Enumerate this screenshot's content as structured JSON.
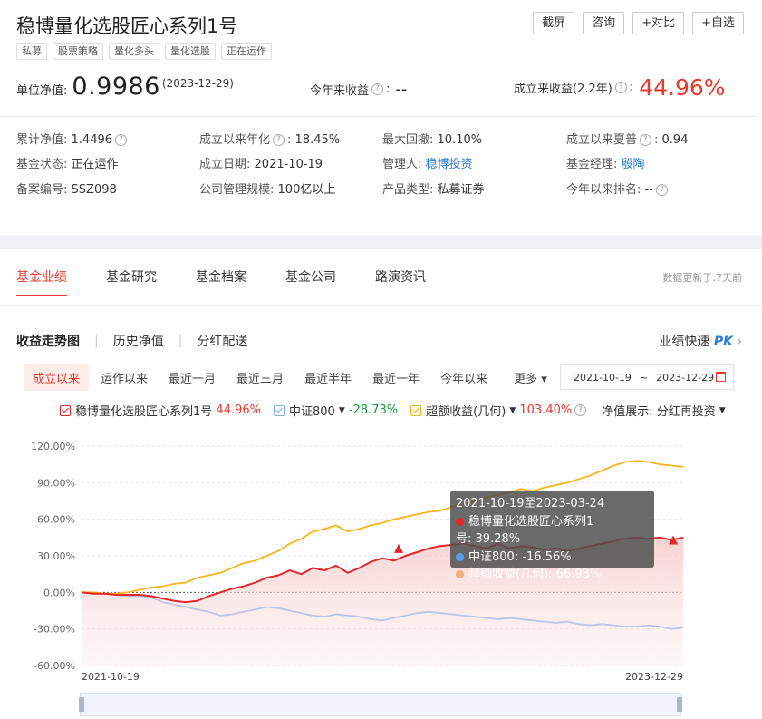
{
  "fund": {
    "title": "稳博量化选股匠心系列1号",
    "tags": [
      "私募",
      "股票策略",
      "量化多头",
      "量化选股",
      "正在运作"
    ]
  },
  "top_buttons": [
    "截屏",
    "咨询",
    "+对比",
    "+自选"
  ],
  "headline": {
    "nav_label": "单位净值:",
    "nav_value": "0.9986",
    "nav_date": "(2023-12-29)",
    "ytd_label": "今年来收益",
    "ytd_value": "--",
    "since_label": "成立来收益(2.2年)",
    "since_value": "44.96%"
  },
  "stats": [
    {
      "label": "累计净值:",
      "value": "1.4496",
      "q": true
    },
    {
      "label": "成立以来年化",
      "value": "18.45%",
      "q": true
    },
    {
      "label": "最大回撤:",
      "value": "10.10%"
    },
    {
      "label": "成立以来夏普",
      "value": "0.94",
      "q": true
    },
    {
      "label": "基金状态:",
      "value": "正在运作"
    },
    {
      "label": "成立日期:",
      "value": "2021-10-19"
    },
    {
      "label": "管理人:",
      "value": "稳博投资",
      "link": true
    },
    {
      "label": "基金经理:",
      "value": "殷陶",
      "link": true
    },
    {
      "label": "备案编号:",
      "value": "SSZ098"
    },
    {
      "label": "公司管理规模:",
      "value": "100亿以上"
    },
    {
      "label": "产品类型:",
      "value": "私募证券"
    },
    {
      "label": "今年以来排名:",
      "value": "--",
      "q": true
    }
  ],
  "tabs": [
    "基金业绩",
    "基金研究",
    "基金档案",
    "基金公司",
    "路演资讯"
  ],
  "update_text": "数据更新于:7天前",
  "subtabs": [
    "收益走势图",
    "历史净值",
    "分红配送"
  ],
  "pk_text": "业绩快速",
  "pk_badge": "PK",
  "ranges": [
    "成立以来",
    "运作以来",
    "最近一月",
    "最近三月",
    "最近半年",
    "最近一年",
    "今年以来",
    "更多"
  ],
  "date_from": "2021-10-19",
  "date_sep": "~",
  "date_to": "2023-12-29",
  "legend": {
    "fund_name": "稳博量化选股匠心系列1号",
    "fund_value": "44.96%",
    "bench_name": "中证800",
    "bench_value": "-28.73%",
    "excess_name": "超额收益(几何)",
    "excess_value": "103.40%",
    "display_label": "净值展示:",
    "display_value": "分红再投资"
  },
  "tooltip": {
    "title": "2021-10-19至2023-03-24",
    "rows": [
      {
        "label": "稳博量化选股匠心系列1号:",
        "value": "39.28%",
        "color": "#e6262d"
      },
      {
        "label": "中证800:",
        "value": "-16.56%",
        "color": "#5aa0e8"
      },
      {
        "label": "超额收益(几何):",
        "value": "66.93%",
        "color": "#f2b07a"
      }
    ]
  },
  "colors": {
    "fund": "#e6262d",
    "bench": "#b8c6e6",
    "excess": "#f5b51b"
  },
  "chart_data": {
    "type": "line",
    "x_start": "2021-10-19",
    "x_end": "2023-12-29",
    "ylim": [
      -60,
      120
    ],
    "yticks": [
      "120.00%",
      "90.00%",
      "60.00%",
      "30.00%",
      "0.00%",
      "-30.00%",
      "-60.00%"
    ],
    "series": [
      {
        "name": "稳博量化选股匠心系列1号",
        "values": [
          0,
          -1,
          -1,
          -2,
          -2,
          -2,
          -3,
          -5,
          -7,
          -8,
          -7,
          -3,
          0,
          3,
          5,
          8,
          12,
          14,
          18,
          15,
          20,
          18,
          22,
          16,
          20,
          25,
          28,
          26,
          30,
          33,
          36,
          38,
          39,
          40,
          38,
          36,
          40,
          36,
          38,
          37,
          35,
          36,
          34,
          36,
          38,
          40,
          42,
          44,
          45,
          44,
          45,
          43,
          45
        ]
      },
      {
        "name": "中证800",
        "values": [
          0,
          -1,
          -1,
          -2,
          -3,
          -3,
          -4,
          -8,
          -10,
          -12,
          -14,
          -16,
          -19,
          -18,
          -16,
          -14,
          -12,
          -13,
          -15,
          -17,
          -19,
          -20,
          -18,
          -19,
          -20,
          -22,
          -23,
          -21,
          -19,
          -17,
          -16,
          -17,
          -18,
          -19,
          -20,
          -21,
          -22,
          -21,
          -22,
          -23,
          -24,
          -25,
          -24,
          -26,
          -27,
          -26,
          -27,
          -28,
          -28,
          -27,
          -28,
          -30,
          -29
        ]
      },
      {
        "name": "超额收益(几何)",
        "values": [
          0,
          0,
          -1,
          -1,
          0,
          2,
          4,
          5,
          7,
          8,
          12,
          14,
          16,
          20,
          24,
          26,
          30,
          34,
          40,
          44,
          50,
          52,
          55,
          50,
          52,
          55,
          57,
          60,
          62,
          64,
          66,
          67,
          70,
          72,
          75,
          78,
          80,
          82,
          85,
          83,
          86,
          88,
          90,
          93,
          96,
          100,
          104,
          107,
          108,
          107,
          105,
          104,
          103
        ]
      }
    ]
  }
}
